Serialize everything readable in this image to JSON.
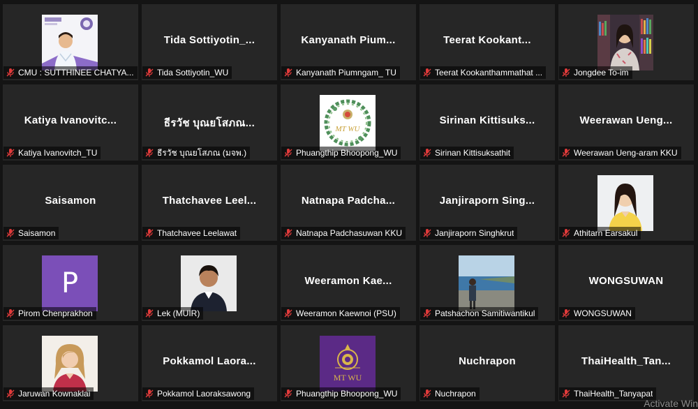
{
  "colors": {
    "tile_bg": "#262626",
    "muted_mic": "#e03a3a",
    "avatar_purple": "#7b4fb8"
  },
  "participants": [
    {
      "display": "image",
      "image": "cmu-logo-slide",
      "label": "CMU : SUTTHINEE CHATYA..."
    },
    {
      "display": "name",
      "big": "Tida  Sottiyotin_...",
      "label": "Tida Sottiyotin_WU"
    },
    {
      "display": "name",
      "big": "Kanyanath  Pium...",
      "label": "Kanyanath Piumngam_ TU"
    },
    {
      "display": "name",
      "big": "Teerat  Kookant...",
      "label": "Teerat Kookanthammathat ..."
    },
    {
      "display": "image",
      "image": "woman-bookshelf",
      "label": "Jongdee To-im"
    },
    {
      "display": "name",
      "big": "Katiya  Ivanovitc...",
      "label": "Katiya Ivanovitch_TU"
    },
    {
      "display": "name",
      "big": "ธีรวัช  บุณยโสภณ...",
      "label": "ธีรวัช บุณยโสภณ (มจพ.)"
    },
    {
      "display": "image",
      "image": "mt-wu-wreath",
      "logo_text": "MT WU",
      "label": "Phuangthip  Bhoopong_WU"
    },
    {
      "display": "name",
      "big": "Sirinan  Kittisuks...",
      "label": "Sirinan Kittisuksathit"
    },
    {
      "display": "name",
      "big": "Weerawan  Ueng...",
      "label": "Weerawan Ueng-aram KKU"
    },
    {
      "display": "name",
      "big": "Saisamon",
      "label": "Saisamon"
    },
    {
      "display": "name",
      "big": "Thatchavee  Leel...",
      "label": "Thatchavee Leelawat"
    },
    {
      "display": "name",
      "big": "Natnapa  Padcha...",
      "label": "Natnapa Padchasuwan KKU"
    },
    {
      "display": "name",
      "big": "Janjiraporn  Sing...",
      "label": "Janjiraporn Singhkrut"
    },
    {
      "display": "image",
      "image": "woman-portrait-light",
      "label": "Athitarn Earsakul"
    },
    {
      "display": "avatar",
      "initial": "P",
      "label": "Pirom Chenprakhon"
    },
    {
      "display": "image",
      "image": "woman-portrait-dark-suit",
      "label": "Lek (MUIR)"
    },
    {
      "display": "name",
      "big": "Weeramon  Kae...",
      "label": "Weeramon Kaewnoi (PSU)"
    },
    {
      "display": "image",
      "image": "person-by-sea",
      "label": "Patshachon Samitiwantikul"
    },
    {
      "display": "name",
      "big": "WONGSUWAN",
      "label": "WONGSUWAN"
    },
    {
      "display": "image",
      "image": "woman-portrait-blonde",
      "label": "Jaruwan Kownaklai"
    },
    {
      "display": "name",
      "big": "Pokkamol  Laora...",
      "label": "Pokkamol Laoraksawong"
    },
    {
      "display": "image",
      "image": "mt-wu-purple-logo",
      "logo_text": "MT WU",
      "label": "Phuangthip Bhoopong_WU"
    },
    {
      "display": "name",
      "big": "Nuchrapon",
      "label": "Nuchrapon"
    },
    {
      "display": "name",
      "big": "ThaiHealth_Tan...",
      "label": "ThaiHealth_Tanyapat"
    }
  ],
  "watermark": "Activate Win"
}
